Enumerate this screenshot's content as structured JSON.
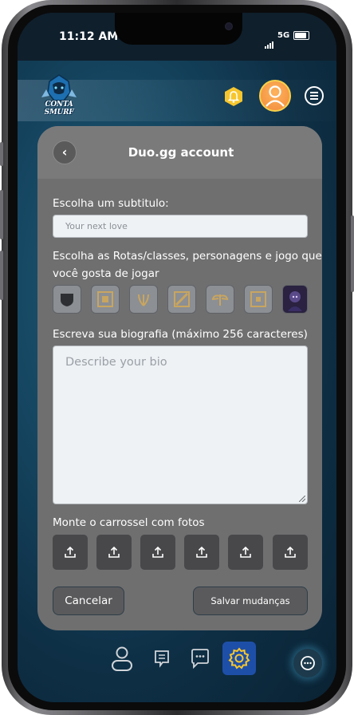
{
  "status_bar": {
    "time": "11:12 AM",
    "network": "5G"
  },
  "header": {
    "logo_text": "CONTA SMURF"
  },
  "panel": {
    "title": "Duo.gg account",
    "subtitle_label": "Escolha um subtitulo:",
    "subtitle_placeholder": "Your next love",
    "roles_label_line1": "Escolha as Rotas/classes, personagens e jogo que",
    "roles_label_line2": "você gosta de jogar",
    "roles": [
      "shield-role",
      "square-role",
      "leaves-role",
      "slash-role",
      "wings-role",
      "square-role-2",
      "champion-portrait"
    ],
    "bio_label": "Escreva sua biografia (máximo 256 caracteres)",
    "bio_placeholder": "Describe your bio",
    "carousel_label": "Monte o carrossel com fotos",
    "photo_slots": 6,
    "cancel_label": "Cancelar",
    "save_label": "Salvar mudanças"
  },
  "bottom_nav": [
    "profile-icon",
    "receipt-icon",
    "messages-icon",
    "settings-icon"
  ],
  "colors": {
    "accent": "#f7c62e",
    "panel": "#6f6f70",
    "active_nav": "#1e4fa8"
  }
}
